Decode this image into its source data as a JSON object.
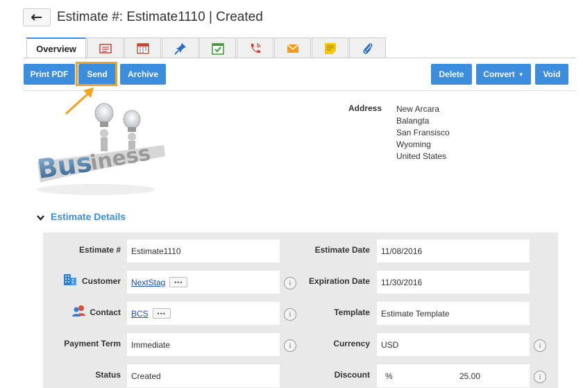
{
  "header": {
    "title": "Estimate #: Estimate1110 | Created"
  },
  "tabs": {
    "overview_label": "Overview",
    "icon_tabs": [
      "notes-icon",
      "calendar-icon",
      "pin-icon",
      "task-icon",
      "call-icon",
      "email-icon",
      "sticky-note-icon",
      "attachment-icon"
    ]
  },
  "toolbar": {
    "print_pdf": "Print PDF",
    "send": "Send",
    "archive": "Archive",
    "delete": "Delete",
    "convert": "Convert",
    "void": "Void"
  },
  "address": {
    "label": "Address",
    "lines": [
      "New Arcara",
      "Balangta",
      "San Fransisco",
      "Wyoming",
      "United States"
    ]
  },
  "section": {
    "title": "Estimate Details"
  },
  "details": {
    "estimate_no_label": "Estimate #",
    "estimate_no_value": "Estimate1110",
    "estimate_date_label": "Estimate Date",
    "estimate_date_value": "11/08/2016",
    "customer_label": "Customer",
    "customer_value": "NextStag",
    "expiration_date_label": "Expiration Date",
    "expiration_date_value": "11/30/2016",
    "contact_label": "Contact",
    "contact_value": "BCS",
    "template_label": "Template",
    "template_value": "Estimate Template",
    "payment_term_label": "Payment Term",
    "payment_term_value": "Immediate",
    "currency_label": "Currency",
    "currency_value": "USD",
    "status_label": "Status",
    "status_value": "Created",
    "discount_label": "Discount",
    "discount_unit": "%",
    "discount_value": "25.00"
  },
  "colors": {
    "accent": "#3c8dde",
    "highlight": "#f4a21c",
    "panel_bg": "#e9e9e9"
  }
}
